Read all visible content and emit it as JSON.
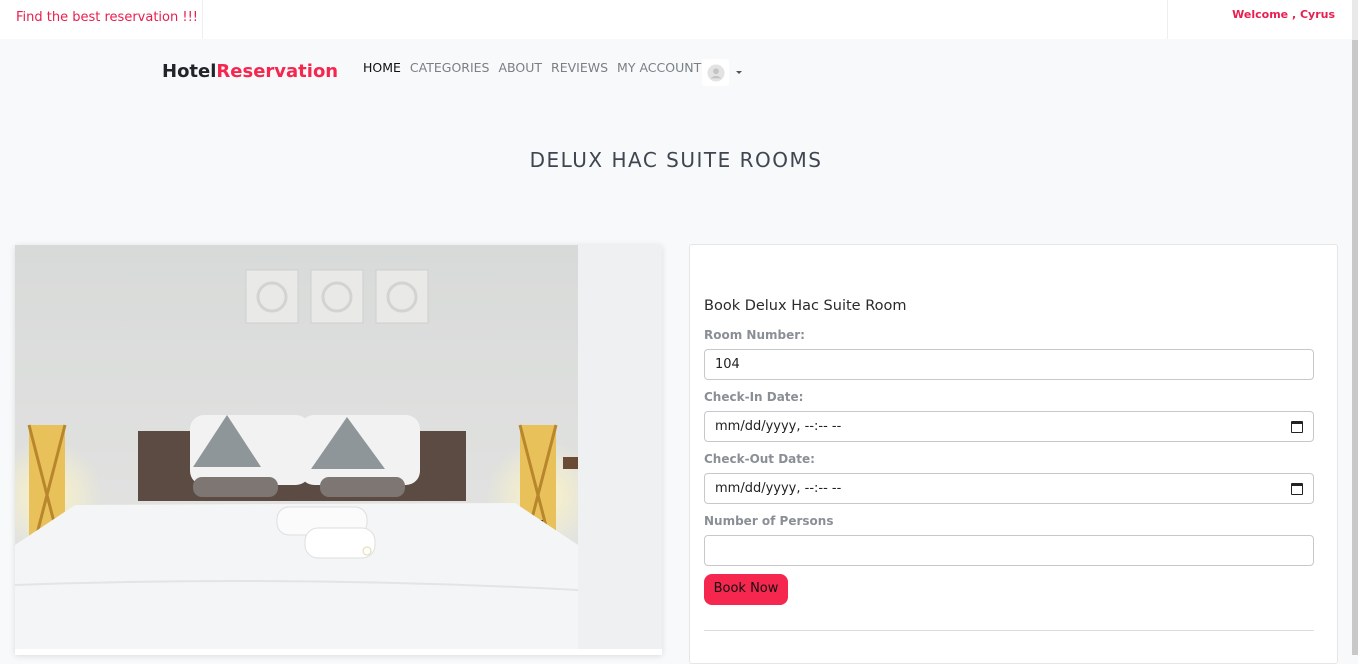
{
  "topbar": {
    "tagline": "Find the best reservation !!!",
    "welcome": "Welcome , Cyrus Mwendwa"
  },
  "brand": {
    "part1": "Hotel",
    "part2": "Reservation",
    "accent_color": "#f5274f"
  },
  "nav": {
    "items": [
      {
        "label": "HOME",
        "active": true
      },
      {
        "label": "CATEGORIES"
      },
      {
        "label": "ABOUT"
      },
      {
        "label": "REVIEWS"
      },
      {
        "label": "MY ACCOUNT"
      }
    ],
    "avatar_icon": "user-avatar-icon"
  },
  "page": {
    "title": "DELUX HAC SUITE ROOMS"
  },
  "booking": {
    "title": "Book Delux Hac Suite Room",
    "room_number_label": "Room Number:",
    "room_number_value": "104",
    "checkin_label": "Check-In Date:",
    "checkin_placeholder": "mm/dd/yyyy, --:-- --",
    "checkout_label": "Check-Out Date:",
    "checkout_placeholder": "mm/dd/yyyy, --:-- --",
    "persons_label": "Number of Persons",
    "persons_value": "",
    "submit_label": "Book Now"
  }
}
